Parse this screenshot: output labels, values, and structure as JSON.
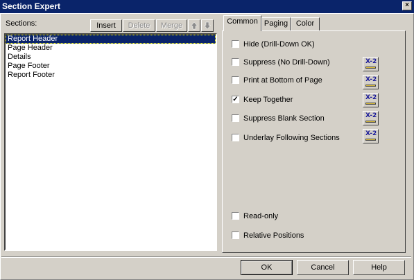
{
  "window": {
    "title": "Section Expert",
    "close_label": "×"
  },
  "sections": {
    "label": "Sections:",
    "toolbar": {
      "insert": "Insert",
      "delete": "Delete",
      "merge": "Merge",
      "up_icon": "arrow-up-icon",
      "down_icon": "arrow-down-icon"
    },
    "items": [
      {
        "label": "Report Header",
        "selected": true
      },
      {
        "label": "Page Header",
        "selected": false
      },
      {
        "label": "Details",
        "selected": false
      },
      {
        "label": "Page Footer",
        "selected": false
      },
      {
        "label": "Report Footer",
        "selected": false
      }
    ]
  },
  "tabs": [
    {
      "label": "Common",
      "active": true
    },
    {
      "label": "Paging",
      "active": false
    },
    {
      "label": "Color",
      "active": false
    }
  ],
  "common": {
    "options": [
      {
        "label": "Hide (Drill-Down OK)",
        "checked": false,
        "formula": false
      },
      {
        "label": "Suppress (No Drill-Down)",
        "checked": false,
        "formula": true
      },
      {
        "label": "Print at Bottom of Page",
        "checked": false,
        "formula": true
      },
      {
        "label": "Keep Together",
        "checked": true,
        "formula": true
      },
      {
        "label": "Suppress Blank Section",
        "checked": false,
        "formula": true
      },
      {
        "label": "Underlay Following Sections",
        "checked": false,
        "formula": true
      }
    ],
    "bottom_options": [
      {
        "label": "Read-only",
        "checked": false
      },
      {
        "label": "Relative Positions",
        "checked": false
      }
    ],
    "formula_button_text": "X-2",
    "formula_icon": "formula-editor-icon"
  },
  "buttons": {
    "ok": "OK",
    "cancel": "Cancel",
    "help": "Help"
  },
  "colors": {
    "titlebar": "#0a246a",
    "face": "#d4d0c8",
    "selection": "#0a246a"
  }
}
